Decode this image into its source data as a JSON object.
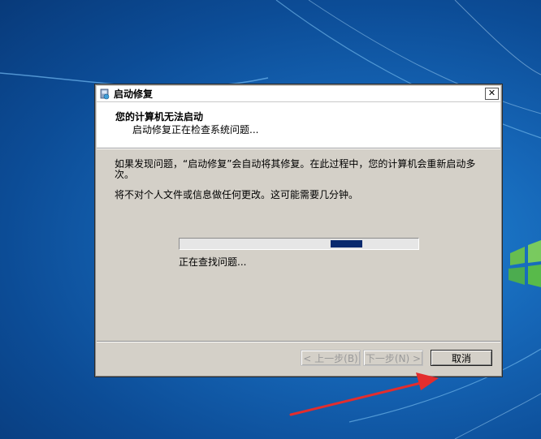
{
  "window": {
    "title": "启动修复",
    "close_label": "✕"
  },
  "header": {
    "title": "您的计算机无法启动",
    "subtitle": "启动修复正在检查系统问题..."
  },
  "body": {
    "paragraph1": "如果发现问题，“启动修复”会自动将其修复。在此过程中，您的计算机会重新启动多次。",
    "paragraph2": "将不对个人文件或信息做任何更改。这可能需要几分钟。"
  },
  "progress": {
    "status": "正在查找问题...",
    "indeterminate": true,
    "fill_color": "#0a2a6e"
  },
  "buttons": {
    "back": "< 上一步(B)",
    "next": "下一步(N) >",
    "cancel": "取消"
  },
  "icons": {
    "app": "startup-repair-icon",
    "close": "close-icon",
    "annotation": "red-arrow"
  },
  "colors": {
    "dialog_bg": "#d4d0c8",
    "annotation_arrow": "#e32d2d"
  }
}
